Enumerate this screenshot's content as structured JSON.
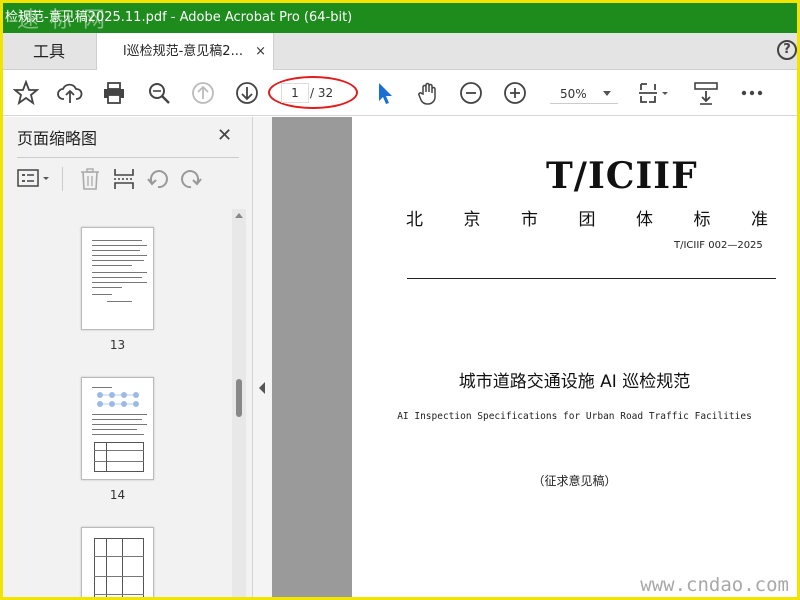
{
  "window": {
    "title": "检规范-意见稿2025.11.pdf - Adobe Acrobat Pro (64-bit)",
    "watermark_top": "速 标 网"
  },
  "tabs": {
    "tools_label": "工具",
    "doc_label": "l巡检规范-意见稿2...",
    "close_glyph": "×",
    "help_glyph": "?"
  },
  "toolbar": {
    "current_page": "1",
    "total_pages": "/ 32",
    "zoom": "50%"
  },
  "sidebar": {
    "title": "页面缩略图",
    "close_glyph": "✕",
    "thumbnails": [
      {
        "label": "13"
      },
      {
        "label": "14"
      },
      {
        "label": ""
      }
    ]
  },
  "document": {
    "std_code": "T/ICIIF",
    "org_chars": [
      "北",
      "京",
      "市",
      "团",
      "体",
      "标",
      "准"
    ],
    "std_number": "T/ICIIF 002—2025",
    "title": "城市道路交通设施 AI 巡检规范",
    "subtitle": "AI Inspection Specifications for Urban Road Traffic Facilities",
    "status": "（征求意见稿）"
  },
  "watermark_bottom": "www.cndao.com",
  "colors": {
    "titlebar": "#1d8c1d",
    "frame": "#f0e400",
    "highlight_oval": "#e21b1b",
    "select_tool": "#1a6fd4"
  }
}
